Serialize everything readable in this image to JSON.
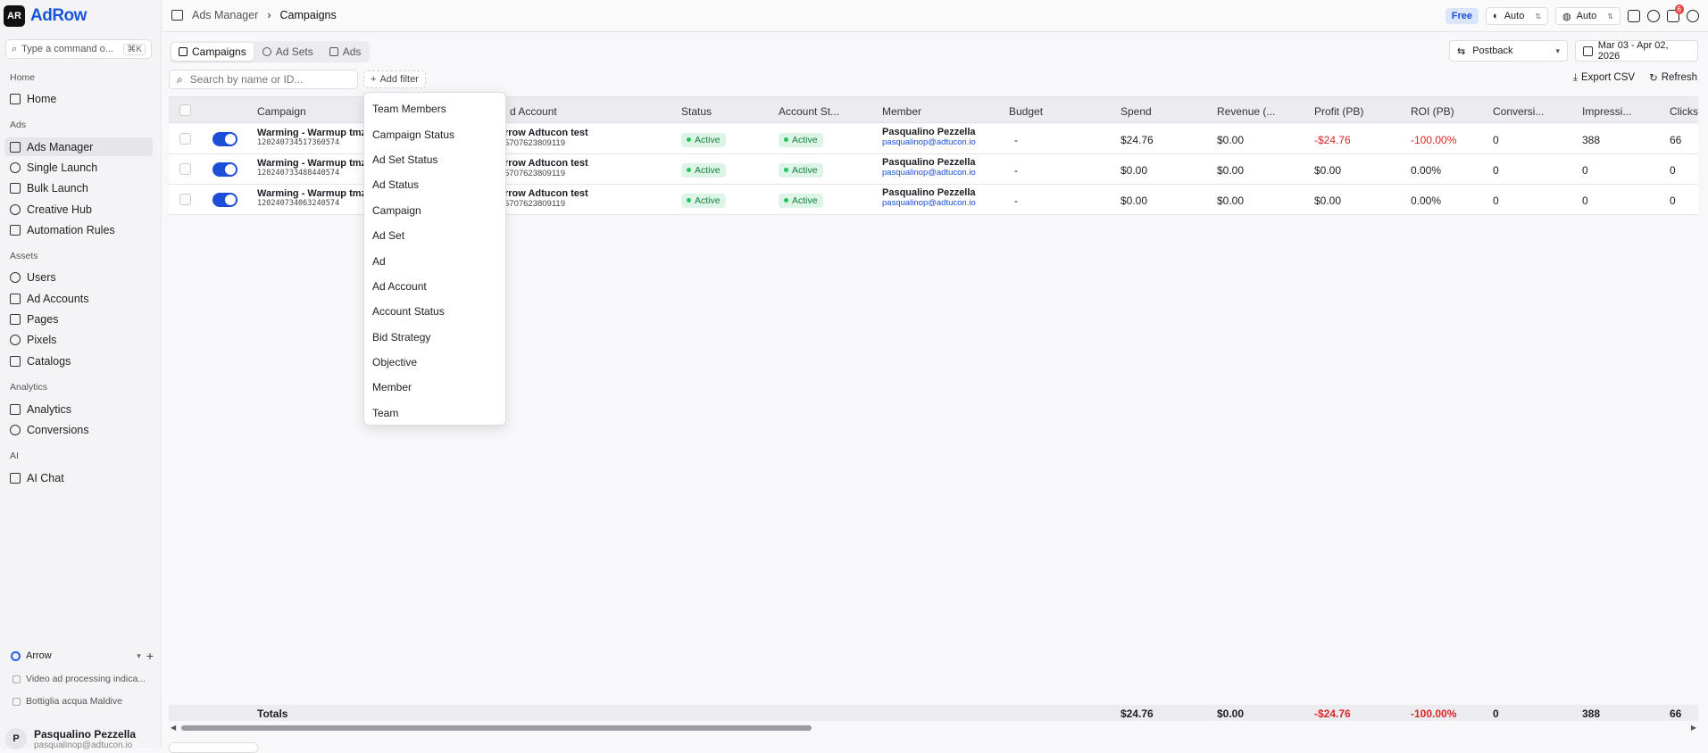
{
  "app": {
    "logo_mark": "AR",
    "name": "AdRow"
  },
  "command": {
    "placeholder": "Type a command o...",
    "shortcut": "⌘K"
  },
  "sidebar": {
    "sections": {
      "home": "Home",
      "ads": "Ads",
      "assets": "Assets",
      "analytics": "Analytics",
      "ai": "AI"
    },
    "items": [
      {
        "label": "Home"
      },
      {
        "label": "Ads Manager"
      },
      {
        "label": "Single Launch"
      },
      {
        "label": "Bulk Launch"
      },
      {
        "label": "Creative Hub"
      },
      {
        "label": "Automation Rules"
      },
      {
        "label": "Users"
      },
      {
        "label": "Ad Accounts"
      },
      {
        "label": "Pages"
      },
      {
        "label": "Pixels"
      },
      {
        "label": "Catalogs"
      },
      {
        "label": "Analytics"
      },
      {
        "label": "Conversions"
      },
      {
        "label": "AI Chat"
      }
    ],
    "workspace": {
      "name": "Arrow",
      "items": [
        "Video ad processing indica...",
        "Bottiglia acqua Maldive"
      ]
    },
    "user": {
      "avatar": "P",
      "name": "Pasqualino Pezzella",
      "email": "pasqualinop@adtucon.io"
    }
  },
  "topbar": {
    "breadcrumb": [
      "Ads Manager",
      "Campaigns"
    ],
    "plan_badge": "Free",
    "theme_select": "Auto",
    "lang_select": "Auto",
    "notification_count": "6"
  },
  "tabs": [
    "Campaigns",
    "Ad Sets",
    "Ads"
  ],
  "attribution": "Postback",
  "date_range": "Mar 03 - Apr 02, 2026",
  "search": {
    "placeholder": "Search by name or ID..."
  },
  "add_filter": "Add filter",
  "actions": {
    "export": "Export CSV",
    "refresh": "Refresh"
  },
  "table": {
    "columns": [
      "Campaign",
      "d Account",
      "Status",
      "Account St...",
      "Member",
      "Budget",
      "Spend",
      "Revenue (...",
      "Profit (PB)",
      "ROI (PB)",
      "Conversi...",
      "Impressi...",
      "Clicks"
    ],
    "rows": [
      {
        "name": "Warming - Warmup tmz 1",
        "id": "120240734517360574",
        "account": "rrow Adtucon test",
        "account_id": "5707623809119",
        "status": "Active",
        "account_status": "Active",
        "member": "Pasqualino Pezzella",
        "member_email": "pasqualinop@adtucon.io",
        "budget": "-",
        "spend": "$24.76",
        "revenue": "$0.00",
        "profit": "-$24.76",
        "roi": "-100.00%",
        "conversions": "0",
        "impressions": "388",
        "clicks": "66"
      },
      {
        "name": "Warming - Warmup tmz 1",
        "id": "120240733488440574",
        "account": "rrow Adtucon test",
        "account_id": "5707623809119",
        "status": "Active",
        "account_status": "Active",
        "member": "Pasqualino Pezzella",
        "member_email": "pasqualinop@adtucon.io",
        "budget": "-",
        "spend": "$0.00",
        "revenue": "$0.00",
        "profit": "$0.00",
        "roi": "0.00%",
        "conversions": "0",
        "impressions": "0",
        "clicks": "0"
      },
      {
        "name": "Warming - Warmup tmz 1",
        "id": "120240734063240574",
        "account": "rrow Adtucon test",
        "account_id": "5707623809119",
        "status": "Active",
        "account_status": "Active",
        "member": "Pasqualino Pezzella",
        "member_email": "pasqualinop@adtucon.io",
        "budget": "-",
        "spend": "$0.00",
        "revenue": "$0.00",
        "profit": "$0.00",
        "roi": "0.00%",
        "conversions": "0",
        "impressions": "0",
        "clicks": "0"
      }
    ],
    "totals": {
      "label": "Totals",
      "spend": "$24.76",
      "revenue": "$0.00",
      "profit": "-$24.76",
      "roi": "-100.00%",
      "conversions": "0",
      "impressions": "388",
      "clicks": "66"
    }
  },
  "filter_menu": [
    "Team Members",
    "Campaign Status",
    "Ad Set Status",
    "Ad Status",
    "Campaign",
    "Ad Set",
    "Ad",
    "Ad Account",
    "Account Status",
    "Bid Strategy",
    "Objective",
    "Member",
    "Team"
  ],
  "colors": {
    "accent": "#1d4ed8",
    "negative": "#dc2626",
    "active_bg": "#dcf5e6",
    "active_text": "#15803d"
  }
}
